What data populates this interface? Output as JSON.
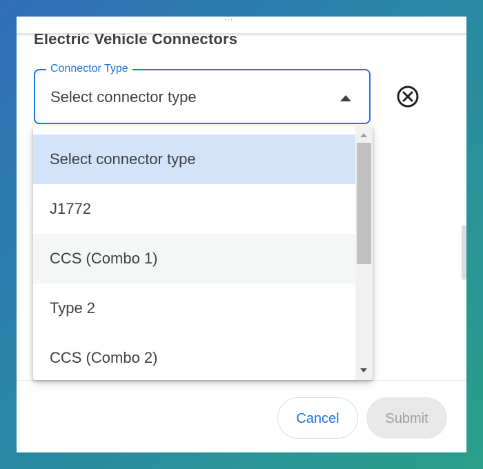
{
  "header": {
    "partial_text": "…"
  },
  "section": {
    "title": "Electric Vehicle Connectors"
  },
  "connector_select": {
    "label": "Connector Type",
    "value": "Select connector type",
    "expanded": true
  },
  "icons": {
    "remove": "close-circle-icon",
    "dropdown": "caret-up-icon"
  },
  "dropdown": {
    "options": [
      {
        "label": "Select connector type",
        "selected": true
      },
      {
        "label": "J1772",
        "selected": false
      },
      {
        "label": "CCS (Combo 1)",
        "selected": false,
        "hovered": true
      },
      {
        "label": "Type 2",
        "selected": false
      },
      {
        "label": "CCS (Combo 2)",
        "selected": false
      }
    ]
  },
  "footer": {
    "cancel_label": "Cancel",
    "submit_label": "Submit",
    "submit_disabled": true
  },
  "colors": {
    "accent": "#1a73e8",
    "selected_option": "#d3e3fa",
    "hover_option": "#f5f7f6",
    "disabled_button": "#e8e8e8"
  }
}
